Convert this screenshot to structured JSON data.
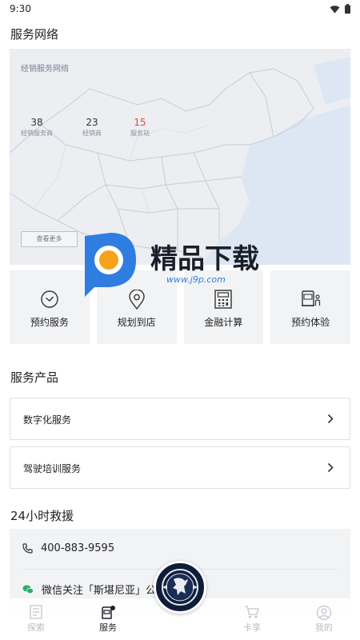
{
  "status_bar": {
    "time": "9:30"
  },
  "network": {
    "title": "服务网络",
    "map_caption": "经销服务网络",
    "stats": [
      {
        "value": "38",
        "label": "经销服务商"
      },
      {
        "value": "23",
        "label": "经销商"
      },
      {
        "value": "15",
        "label": "服务站"
      }
    ],
    "more_button": "查看更多",
    "stat_highlight_color": "#e5483e"
  },
  "watermark": {
    "title": "精品下载",
    "url": "www.j9p.com"
  },
  "quick_actions": [
    {
      "label": "预约服务",
      "icon": "clock-icon"
    },
    {
      "label": "规划到店",
      "icon": "location-pin-icon"
    },
    {
      "label": "金融计算",
      "icon": "calculator-icon"
    },
    {
      "label": "预约体验",
      "icon": "truck-driver-icon"
    }
  ],
  "products": {
    "title": "服务产品",
    "items": [
      {
        "label": "数字化服务"
      },
      {
        "label": "驾驶培训服务"
      }
    ]
  },
  "rescue": {
    "title": "24小时救援",
    "phone": "400-883-9595",
    "wechat": "微信关注「斯堪尼亚」公"
  },
  "tabbar": {
    "tabs": [
      {
        "label": "探索",
        "icon": "explore-icon",
        "active": false
      },
      {
        "label": "服务",
        "icon": "service-icon",
        "active": true
      },
      {
        "label": "卡享",
        "icon": "cart-icon",
        "active": false
      },
      {
        "label": "我的",
        "icon": "profile-icon",
        "active": false
      }
    ],
    "center_icon": "griffin-logo-icon"
  }
}
